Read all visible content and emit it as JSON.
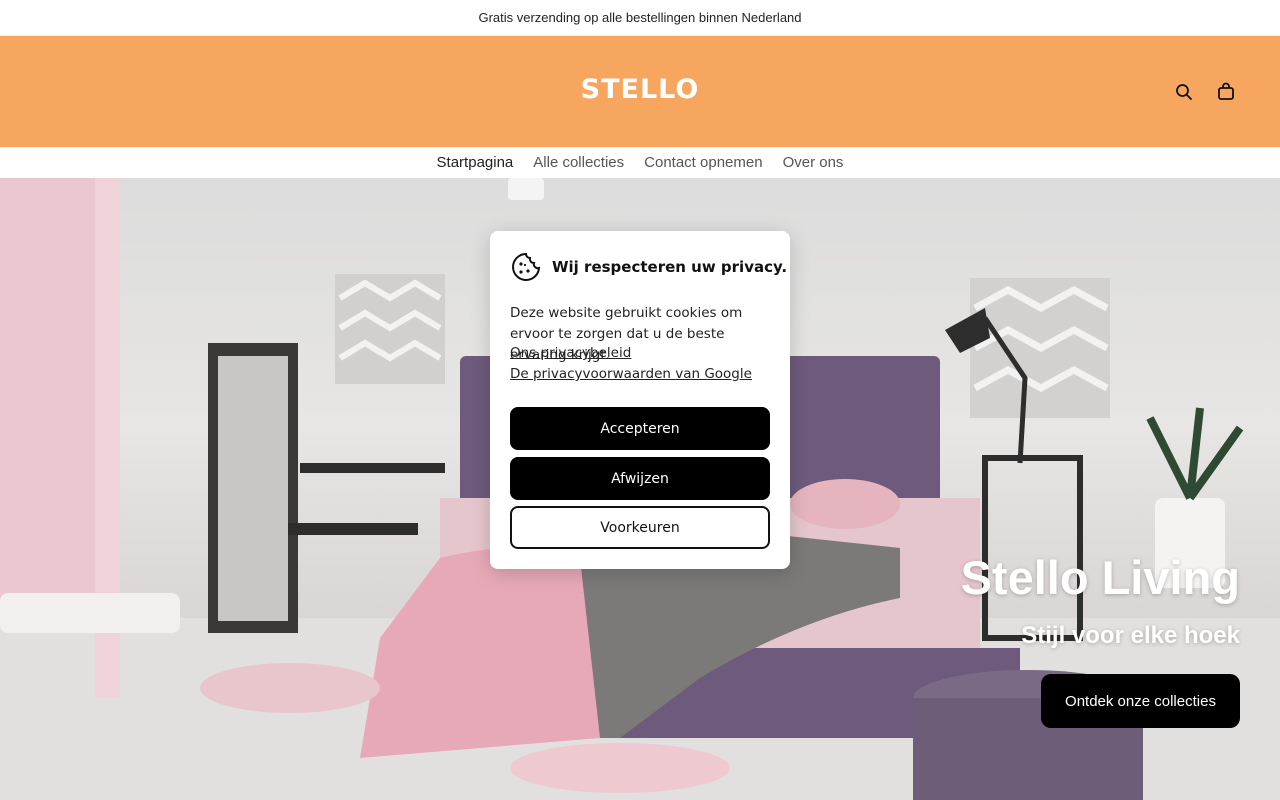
{
  "announcement": "Gratis verzending op alle bestellingen binnen Nederland",
  "header": {
    "logo": "STELLO",
    "bg_color": "#f7a660",
    "icons": [
      "search-icon",
      "bag-icon"
    ]
  },
  "nav": {
    "items": [
      {
        "label": "Startpagina",
        "active": true
      },
      {
        "label": "Alle collecties",
        "active": false
      },
      {
        "label": "Contact opnemen",
        "active": false
      },
      {
        "label": "Over ons",
        "active": false
      }
    ]
  },
  "hero": {
    "title": "Stello Living",
    "subtitle": "Stijl voor elke hoek",
    "button": "Ontdek onze collecties"
  },
  "cookie": {
    "icon": "cookie-icon",
    "title": "Wij respecteren uw privacy.",
    "text": "Deze website gebruikt cookies om ervoor te zorgen dat u de beste ervaring krijgt.",
    "link_privacy": "Ons privacybeleid",
    "link_google": "De privacyvoorwaarden van Google",
    "accept": "Accepteren",
    "decline": "Afwijzen",
    "preferences": "Voorkeuren"
  }
}
